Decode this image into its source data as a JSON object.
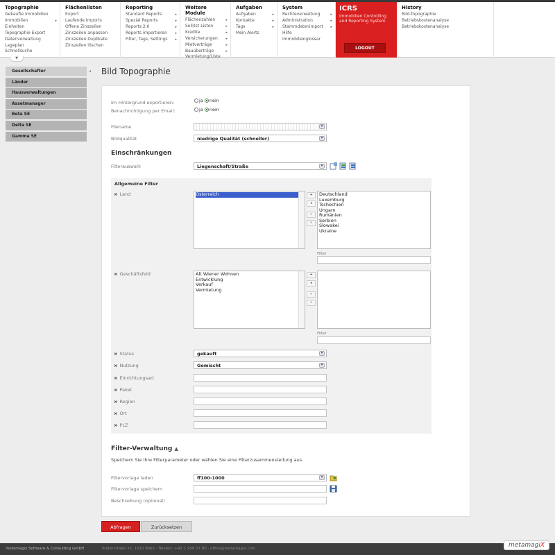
{
  "menu": {
    "columns": [
      {
        "head": "Topographie",
        "items": [
          [
            "Gekaufte Immobilien",
            ""
          ],
          [
            "Immobilien",
            "▸"
          ],
          [
            "Einheiten",
            ""
          ],
          [
            "Topographie Export",
            ""
          ],
          [
            "Datenverwaltung",
            ""
          ],
          [
            "Lageplan",
            ""
          ],
          [
            "Schnellsuche",
            ""
          ]
        ]
      },
      {
        "head": "Flächenlisten",
        "items": [
          [
            "Export",
            ""
          ],
          [
            "Laufende Imports",
            ""
          ],
          [
            "Offene Zinszeilen",
            ""
          ],
          [
            "Zinszeilen anpassen",
            ""
          ],
          [
            "Zinszeilen Duplikate",
            ""
          ],
          [
            "Zinszeilen löschen",
            ""
          ]
        ]
      },
      {
        "head": "Reporting",
        "items": [
          [
            "Standard Reports",
            "▸"
          ],
          [
            "Spezial Reports",
            "▸"
          ],
          [
            "Reports 2.0",
            "▸"
          ],
          [
            "Reports importieren",
            "▸"
          ],
          [
            "Filter, Tags, Settings",
            "▸"
          ]
        ]
      },
      {
        "head": "Weitere Module",
        "items": [
          [
            "Flächenzahlen",
            "▸"
          ],
          [
            "Soll/Ist-Listen",
            "▸"
          ],
          [
            "Kredite",
            "▸"
          ],
          [
            "Versicherungen",
            "▸"
          ],
          [
            "Mietverträge",
            "▸"
          ],
          [
            "Bauüberträge",
            "▸"
          ],
          [
            "Vermietung/Liste",
            ""
          ]
        ]
      },
      {
        "head": "Aufgaben",
        "items": [
          [
            "Aufgaben",
            "▸"
          ],
          [
            "Kontakte",
            "▸"
          ],
          [
            "Tags",
            "▸"
          ],
          [
            "Mein Alerts",
            ""
          ]
        ]
      },
      {
        "head": "System",
        "items": [
          [
            "Rechteverwaltung",
            "▸"
          ],
          [
            "Administration",
            "▸"
          ],
          [
            "Stammdatenimport",
            "▸"
          ],
          [
            "Hilfe",
            ""
          ],
          [
            "Immobilienglossar",
            ""
          ]
        ]
      },
      {
        "head": "History",
        "items": [
          [
            "Bild-Topographie",
            ""
          ],
          [
            "Betriebskostenanalyse",
            ""
          ],
          [
            "Betriebskostenanalyse",
            ""
          ]
        ]
      }
    ],
    "icrs": {
      "title": "ICRS",
      "subtitle": "Immobilien Controlling and Reporting System",
      "logout": "LOGOUT"
    }
  },
  "sidebar": {
    "items": [
      "Gesellschafter",
      "Länder",
      "Hausverwaltungen",
      "Assetmanager",
      "Beta SE",
      "Delta SE",
      "Gamma SE"
    ]
  },
  "page_title": "Bild Topographie",
  "form": {
    "hintergrund_label": "Im Hintergrund exportieren:",
    "email_label": "Benachrichtigung per Email:",
    "radio_ja": "ja",
    "radio_nein": "nein",
    "filename_label": "Filename",
    "filename_value": "",
    "bildqualitaet_label": "Bildqualität",
    "bildqualitaet_value": "niedrige Qualität (schneller)",
    "einschraenkungen": "Einschränkungen",
    "filterauswahl_label": "Filterauswahl",
    "filterauswahl_value": "Liegenschaft/Straße",
    "allgemeine_filter": "Allgemeine Filter",
    "land_label": "Land",
    "land_selected": [
      "Österreich"
    ],
    "land_available": [
      "Deutschland",
      "Luxemburg",
      "Tschechien",
      "Ungarn",
      "Rumänien",
      "Serbien",
      "Slowakei",
      "Ukraine"
    ],
    "filter_label": "Filter",
    "geschaeftsfeld_label": "Geschäftsfeld",
    "geschaeftsfeld_selected": [
      "Alt Wiener Wohnen",
      "Entwicklung",
      "Verkauf",
      "Vermietung"
    ],
    "status_label": "Status",
    "status_value": "gekauft",
    "nutzung_label": "Nutzung",
    "nutzung_value": "Gemischt",
    "einrichtungsart_label": "Einrichtungsart",
    "paket_label": "Paket",
    "region_label": "Region",
    "ort_label": "Ort",
    "plz_label": "PLZ",
    "filterverwaltung": "Filter-Verwaltung",
    "filterverwaltung_desc": "Speichern Sie Ihre Filterparameter oder wählen Sie eine Filterzusammenstellung aus.",
    "filtervorlage_laden_label": "Filtervorlage laden",
    "filtervorlage_laden_value": "ff100-1000",
    "filtervorlage_speichern_label": "Filtervorlage speichern",
    "beschreibung_label": "Beschreibung (optional)"
  },
  "buttons": {
    "abfragen": "Abfragen",
    "reset": "Zurücksetzen"
  },
  "footer": {
    "company": "metamagix Software & Consulting GmbH",
    "address": "Praterstraße 33, 1020 Wien · Telefon: +43 1 958 07 80 · office@metamagix.com",
    "logo_text": "metamagi",
    "logo_accent": "X"
  }
}
